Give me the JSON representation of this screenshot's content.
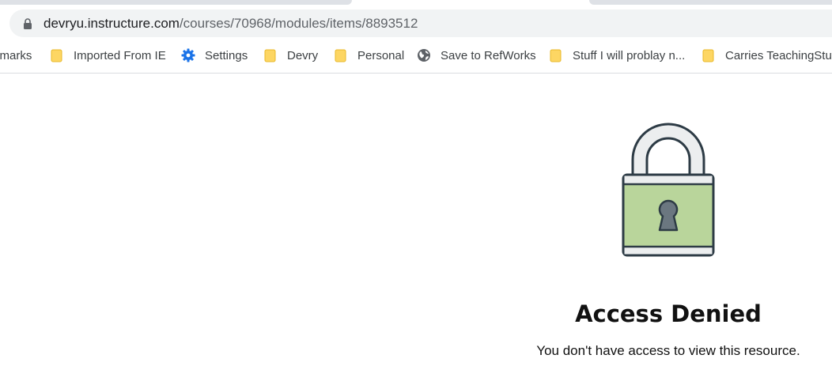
{
  "browser": {
    "url_host": "devryu.instructure.com",
    "url_path": "/courses/70968/modules/items/8893512"
  },
  "bookmarks": [
    {
      "label": "kmarks",
      "icon": "none"
    },
    {
      "label": "Imported From IE",
      "icon": "folder-icon"
    },
    {
      "label": "Settings",
      "icon": "gear-icon"
    },
    {
      "label": "Devry",
      "icon": "folder-icon"
    },
    {
      "label": "Personal",
      "icon": "folder-icon"
    },
    {
      "label": "Save to RefWorks",
      "icon": "globe-icon"
    },
    {
      "label": "Stuff I will problay n...",
      "icon": "folder-icon"
    },
    {
      "label": "Carries TeachingStuff",
      "icon": "folder-icon"
    }
  ],
  "page": {
    "title": "Access Denied",
    "message": "You don't have access to view this resource."
  },
  "colors": {
    "folder": "#fdd663",
    "gear": "#1a73e8",
    "lock_body": "#b9d59b",
    "lock_outline": "#2d3b45",
    "keyhole": "#6b7780"
  }
}
